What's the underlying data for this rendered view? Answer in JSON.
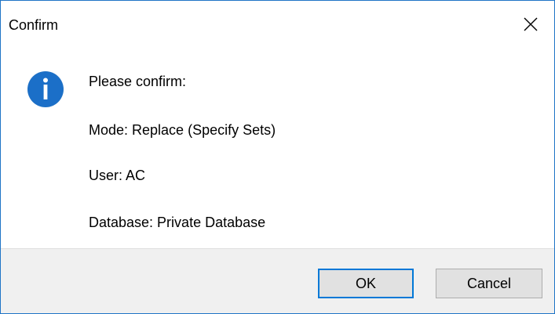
{
  "window": {
    "title": "Confirm",
    "accent_color": "#0078d7"
  },
  "icons": {
    "info": "info-icon",
    "close": "close-icon"
  },
  "message": {
    "line1": "Please confirm:",
    "line2": "Mode: Replace (Specify Sets)",
    "line3": "User: AC",
    "line4": "Database: Private Database"
  },
  "buttons": {
    "ok_label": "OK",
    "cancel_label": "Cancel"
  }
}
